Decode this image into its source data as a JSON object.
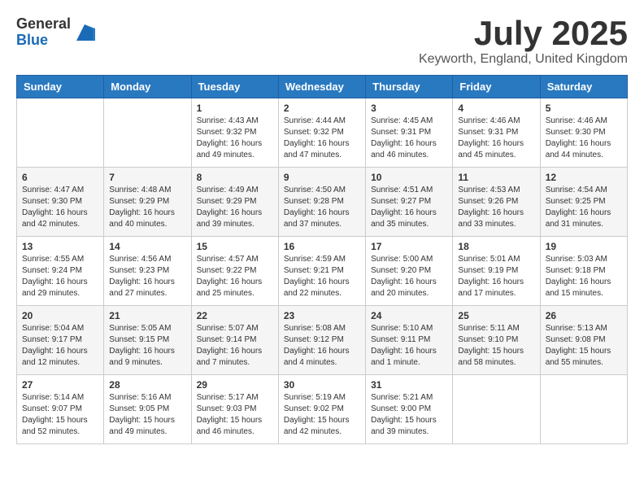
{
  "header": {
    "logo_general": "General",
    "logo_blue": "Blue",
    "title": "July 2025",
    "location": "Keyworth, England, United Kingdom"
  },
  "days_of_week": [
    "Sunday",
    "Monday",
    "Tuesday",
    "Wednesday",
    "Thursday",
    "Friday",
    "Saturday"
  ],
  "weeks": [
    [
      {
        "day": "",
        "info": ""
      },
      {
        "day": "",
        "info": ""
      },
      {
        "day": "1",
        "info": "Sunrise: 4:43 AM\nSunset: 9:32 PM\nDaylight: 16 hours and 49 minutes."
      },
      {
        "day": "2",
        "info": "Sunrise: 4:44 AM\nSunset: 9:32 PM\nDaylight: 16 hours and 47 minutes."
      },
      {
        "day": "3",
        "info": "Sunrise: 4:45 AM\nSunset: 9:31 PM\nDaylight: 16 hours and 46 minutes."
      },
      {
        "day": "4",
        "info": "Sunrise: 4:46 AM\nSunset: 9:31 PM\nDaylight: 16 hours and 45 minutes."
      },
      {
        "day": "5",
        "info": "Sunrise: 4:46 AM\nSunset: 9:30 PM\nDaylight: 16 hours and 44 minutes."
      }
    ],
    [
      {
        "day": "6",
        "info": "Sunrise: 4:47 AM\nSunset: 9:30 PM\nDaylight: 16 hours and 42 minutes."
      },
      {
        "day": "7",
        "info": "Sunrise: 4:48 AM\nSunset: 9:29 PM\nDaylight: 16 hours and 40 minutes."
      },
      {
        "day": "8",
        "info": "Sunrise: 4:49 AM\nSunset: 9:29 PM\nDaylight: 16 hours and 39 minutes."
      },
      {
        "day": "9",
        "info": "Sunrise: 4:50 AM\nSunset: 9:28 PM\nDaylight: 16 hours and 37 minutes."
      },
      {
        "day": "10",
        "info": "Sunrise: 4:51 AM\nSunset: 9:27 PM\nDaylight: 16 hours and 35 minutes."
      },
      {
        "day": "11",
        "info": "Sunrise: 4:53 AM\nSunset: 9:26 PM\nDaylight: 16 hours and 33 minutes."
      },
      {
        "day": "12",
        "info": "Sunrise: 4:54 AM\nSunset: 9:25 PM\nDaylight: 16 hours and 31 minutes."
      }
    ],
    [
      {
        "day": "13",
        "info": "Sunrise: 4:55 AM\nSunset: 9:24 PM\nDaylight: 16 hours and 29 minutes."
      },
      {
        "day": "14",
        "info": "Sunrise: 4:56 AM\nSunset: 9:23 PM\nDaylight: 16 hours and 27 minutes."
      },
      {
        "day": "15",
        "info": "Sunrise: 4:57 AM\nSunset: 9:22 PM\nDaylight: 16 hours and 25 minutes."
      },
      {
        "day": "16",
        "info": "Sunrise: 4:59 AM\nSunset: 9:21 PM\nDaylight: 16 hours and 22 minutes."
      },
      {
        "day": "17",
        "info": "Sunrise: 5:00 AM\nSunset: 9:20 PM\nDaylight: 16 hours and 20 minutes."
      },
      {
        "day": "18",
        "info": "Sunrise: 5:01 AM\nSunset: 9:19 PM\nDaylight: 16 hours and 17 minutes."
      },
      {
        "day": "19",
        "info": "Sunrise: 5:03 AM\nSunset: 9:18 PM\nDaylight: 16 hours and 15 minutes."
      }
    ],
    [
      {
        "day": "20",
        "info": "Sunrise: 5:04 AM\nSunset: 9:17 PM\nDaylight: 16 hours and 12 minutes."
      },
      {
        "day": "21",
        "info": "Sunrise: 5:05 AM\nSunset: 9:15 PM\nDaylight: 16 hours and 9 minutes."
      },
      {
        "day": "22",
        "info": "Sunrise: 5:07 AM\nSunset: 9:14 PM\nDaylight: 16 hours and 7 minutes."
      },
      {
        "day": "23",
        "info": "Sunrise: 5:08 AM\nSunset: 9:12 PM\nDaylight: 16 hours and 4 minutes."
      },
      {
        "day": "24",
        "info": "Sunrise: 5:10 AM\nSunset: 9:11 PM\nDaylight: 16 hours and 1 minute."
      },
      {
        "day": "25",
        "info": "Sunrise: 5:11 AM\nSunset: 9:10 PM\nDaylight: 15 hours and 58 minutes."
      },
      {
        "day": "26",
        "info": "Sunrise: 5:13 AM\nSunset: 9:08 PM\nDaylight: 15 hours and 55 minutes."
      }
    ],
    [
      {
        "day": "27",
        "info": "Sunrise: 5:14 AM\nSunset: 9:07 PM\nDaylight: 15 hours and 52 minutes."
      },
      {
        "day": "28",
        "info": "Sunrise: 5:16 AM\nSunset: 9:05 PM\nDaylight: 15 hours and 49 minutes."
      },
      {
        "day": "29",
        "info": "Sunrise: 5:17 AM\nSunset: 9:03 PM\nDaylight: 15 hours and 46 minutes."
      },
      {
        "day": "30",
        "info": "Sunrise: 5:19 AM\nSunset: 9:02 PM\nDaylight: 15 hours and 42 minutes."
      },
      {
        "day": "31",
        "info": "Sunrise: 5:21 AM\nSunset: 9:00 PM\nDaylight: 15 hours and 39 minutes."
      },
      {
        "day": "",
        "info": ""
      },
      {
        "day": "",
        "info": ""
      }
    ]
  ]
}
